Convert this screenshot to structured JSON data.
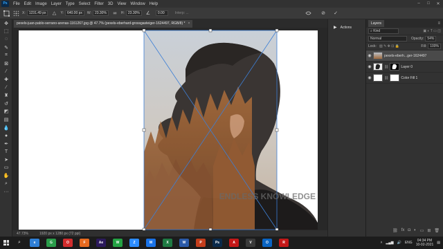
{
  "menubar": {
    "logo": "Ps",
    "items": [
      "File",
      "Edit",
      "Image",
      "Layer",
      "Type",
      "Select",
      "Filter",
      "3D",
      "View",
      "Window",
      "Help"
    ],
    "window_controls": [
      "–",
      "□",
      "✕"
    ]
  },
  "options": {
    "x_label": "X:",
    "x_value": "1231.49 px",
    "y_label": "Y:",
    "y_value": "640.00 px",
    "w_label": "W:",
    "w_value": "23.30%",
    "h_label": "H:",
    "h_value": "23.30%",
    "angle_value": "0.00",
    "interp_label": "Interp: ...",
    "cancel_icon": "⊘",
    "commit_icon": "✓"
  },
  "document": {
    "tab_title": "pexels-juan-pablo-serrano-arenas-1161267.jpg @ 47.7% (pexels-eberhard-grossgasteiger-1624497, RGB/8) *",
    "close_icon": "×"
  },
  "watermark": "ENDLESS KNOWLEDGE",
  "status": {
    "zoom": "47.73%",
    "size": "1920 px x 1280 px (72 ppi)"
  },
  "actions_panel": {
    "label": "Actions"
  },
  "layers_panel": {
    "tab": "Layers",
    "kind_label": "Kind",
    "blend_mode": "Normal",
    "opacity_label": "Opacity:",
    "opacity_value": "54%",
    "lock_label": "Lock:",
    "fill_label": "Fill:",
    "fill_value": "100%",
    "layers": [
      {
        "name": "pexels-eberh...ger-1624497"
      },
      {
        "name": "Layer 0"
      },
      {
        "name": "Color Fill 1"
      }
    ]
  },
  "taskbar": {
    "apps": [
      {
        "label": "e",
        "color": "#2f7fd6"
      },
      {
        "label": "G",
        "color": "#2a9d4a"
      },
      {
        "label": "O",
        "color": "#d12d2d"
      },
      {
        "label": "F",
        "color": "#e66a1f"
      },
      {
        "label": "Ae",
        "color": "#2c1a5c"
      },
      {
        "label": "W",
        "color": "#25a244"
      },
      {
        "label": "Z",
        "color": "#2d8cff"
      },
      {
        "label": "M",
        "color": "#1a73e8"
      },
      {
        "label": "X",
        "color": "#1f7a43"
      },
      {
        "label": "W",
        "color": "#2b5aa8"
      },
      {
        "label": "P",
        "color": "#c43e1c"
      },
      {
        "label": "Ps",
        "color": "#0b2a4a"
      },
      {
        "label": "A",
        "color": "#c41818"
      },
      {
        "label": "V",
        "color": "#3a3a3a"
      },
      {
        "label": "O",
        "color": "#0a64c2"
      },
      {
        "label": "R",
        "color": "#c41818"
      }
    ],
    "lang": "ENG",
    "time": "04:34 PM",
    "date": "10-02-2021"
  }
}
